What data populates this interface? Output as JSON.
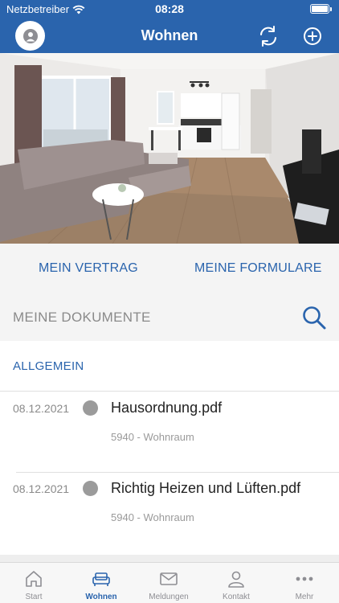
{
  "status": {
    "carrier": "Netzbetreiber",
    "time": "08:28"
  },
  "header": {
    "title": "Wohnen"
  },
  "links": {
    "vertrag": "MEIN VERTRAG",
    "formulare": "MEINE FORMULARE"
  },
  "documents_section": {
    "title": "MEINE DOKUMENTE"
  },
  "category": {
    "label": "ALLGEMEIN"
  },
  "documents": [
    {
      "date": "08.12.2021",
      "name": "Hausordnung.pdf",
      "sub": "5940 - Wohnraum"
    },
    {
      "date": "08.12.2021",
      "name": "Richtig Heizen und Lüften.pdf",
      "sub": "5940 - Wohnraum"
    }
  ],
  "tabs": [
    {
      "label": "Start",
      "icon": "home-icon"
    },
    {
      "label": "Wohnen",
      "icon": "sofa-icon"
    },
    {
      "label": "Meldungen",
      "icon": "mail-icon"
    },
    {
      "label": "Kontakt",
      "icon": "person-icon"
    },
    {
      "label": "Mehr",
      "icon": "more-icon"
    }
  ],
  "colors": {
    "primary": "#2a64ad",
    "inactive": "#8e8e93"
  }
}
